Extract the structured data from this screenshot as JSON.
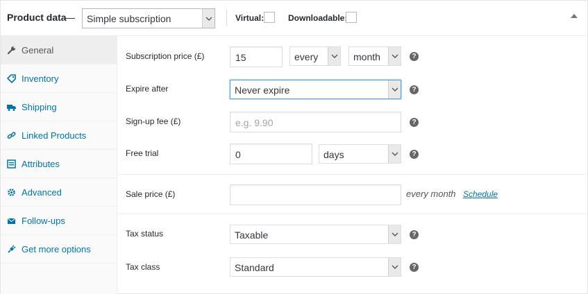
{
  "header": {
    "title": "Product data",
    "dash": "—",
    "product_type": "Simple subscription",
    "virtual_label": "Virtual:",
    "virtual_checked": false,
    "downloadable_label": "Downloadable:",
    "downloadable_checked": false
  },
  "sidebar": {
    "items": [
      {
        "label": "General",
        "icon": "wrench-icon",
        "active": true
      },
      {
        "label": "Inventory",
        "icon": "tag-icon",
        "active": false
      },
      {
        "label": "Shipping",
        "icon": "truck-icon",
        "active": false
      },
      {
        "label": "Linked Products",
        "icon": "link-icon",
        "active": false
      },
      {
        "label": "Attributes",
        "icon": "list-icon",
        "active": false
      },
      {
        "label": "Advanced",
        "icon": "gear-icon",
        "active": false
      },
      {
        "label": "Follow-ups",
        "icon": "envelope-icon",
        "active": false
      },
      {
        "label": "Get more options",
        "icon": "plug-icon",
        "active": false
      }
    ]
  },
  "fields": {
    "subscription_price": {
      "label": "Subscription price (£)",
      "value": "15",
      "interval": "every",
      "period": "month"
    },
    "expire_after": {
      "label": "Expire after",
      "value": "Never expire"
    },
    "signup_fee": {
      "label": "Sign-up fee (£)",
      "placeholder": "e.g. 9.90"
    },
    "free_trial": {
      "label": "Free trial",
      "value": "0",
      "unit": "days"
    },
    "sale_price": {
      "label": "Sale price (£)",
      "value": "",
      "suffix": "every month",
      "schedule_link": "Schedule"
    },
    "tax_status": {
      "label": "Tax status",
      "value": "Taxable"
    },
    "tax_class": {
      "label": "Tax class",
      "value": "Standard"
    }
  },
  "help_glyph": "?",
  "colors": {
    "link": "#0073aa",
    "focus": "#5b9dd9",
    "help": "#666666"
  }
}
